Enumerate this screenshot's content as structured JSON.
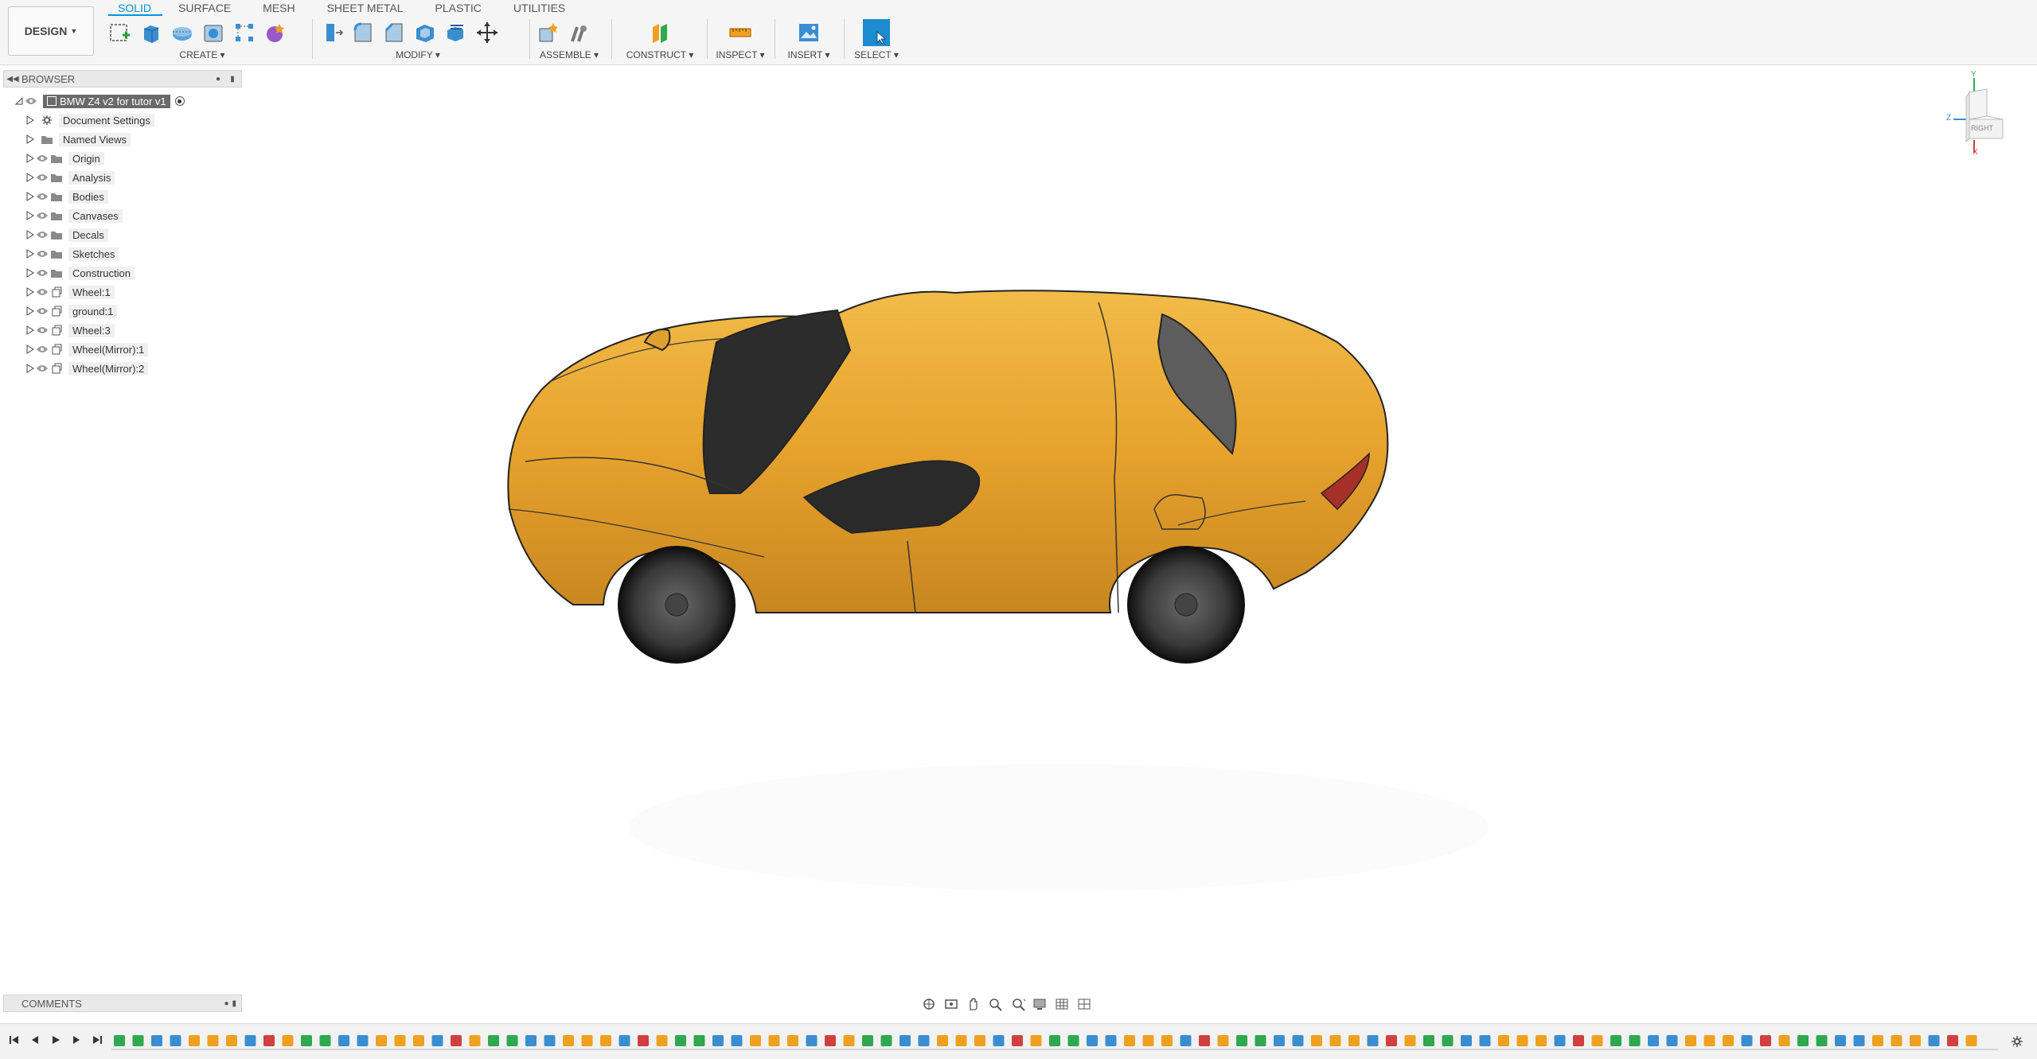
{
  "toolbar": {
    "workspace": "DESIGN",
    "tabs": [
      "SOLID",
      "SURFACE",
      "MESH",
      "SHEET METAL",
      "PLASTIC",
      "UTILITIES"
    ],
    "active_tab": "SOLID",
    "groups": {
      "create": "CREATE",
      "modify": "MODIFY",
      "assemble": "ASSEMBLE",
      "construct": "CONSTRUCT",
      "inspect": "INSPECT",
      "insert": "INSERT",
      "select": "SELECT"
    }
  },
  "browser": {
    "title": "BROWSER",
    "root": "BMW Z4 v2 for tutor v1",
    "items": [
      {
        "label": "Document Settings",
        "icon": "gear-icon",
        "eye": false
      },
      {
        "label": "Named Views",
        "icon": "folder-icon",
        "eye": false
      },
      {
        "label": "Origin",
        "icon": "folder-icon",
        "eye": true
      },
      {
        "label": "Analysis",
        "icon": "folder-icon",
        "eye": true
      },
      {
        "label": "Bodies",
        "icon": "folder-icon",
        "eye": true
      },
      {
        "label": "Canvases",
        "icon": "folder-icon",
        "eye": true
      },
      {
        "label": "Decals",
        "icon": "folder-icon",
        "eye": true
      },
      {
        "label": "Sketches",
        "icon": "folder-icon",
        "eye": true
      },
      {
        "label": "Construction",
        "icon": "folder-icon",
        "eye": true
      },
      {
        "label": "Wheel:1",
        "icon": "component-icon",
        "eye": true
      },
      {
        "label": "ground:1",
        "icon": "component-icon",
        "eye": true
      },
      {
        "label": "Wheel:3",
        "icon": "component-icon",
        "eye": true
      },
      {
        "label": "Wheel(Mirror):1",
        "icon": "component-icon",
        "eye": true
      },
      {
        "label": "Wheel(Mirror):2",
        "icon": "component-icon",
        "eye": true
      }
    ]
  },
  "viewcube": {
    "face": "RIGHT",
    "axis_y": "Y",
    "axis_z": "Z",
    "axis_x": "X"
  },
  "comments": {
    "title": "COMMENTS"
  },
  "colors": {
    "accent": "#0696d7",
    "car_body": "#e8a630",
    "toolbar_bg": "#f5f5f5"
  }
}
